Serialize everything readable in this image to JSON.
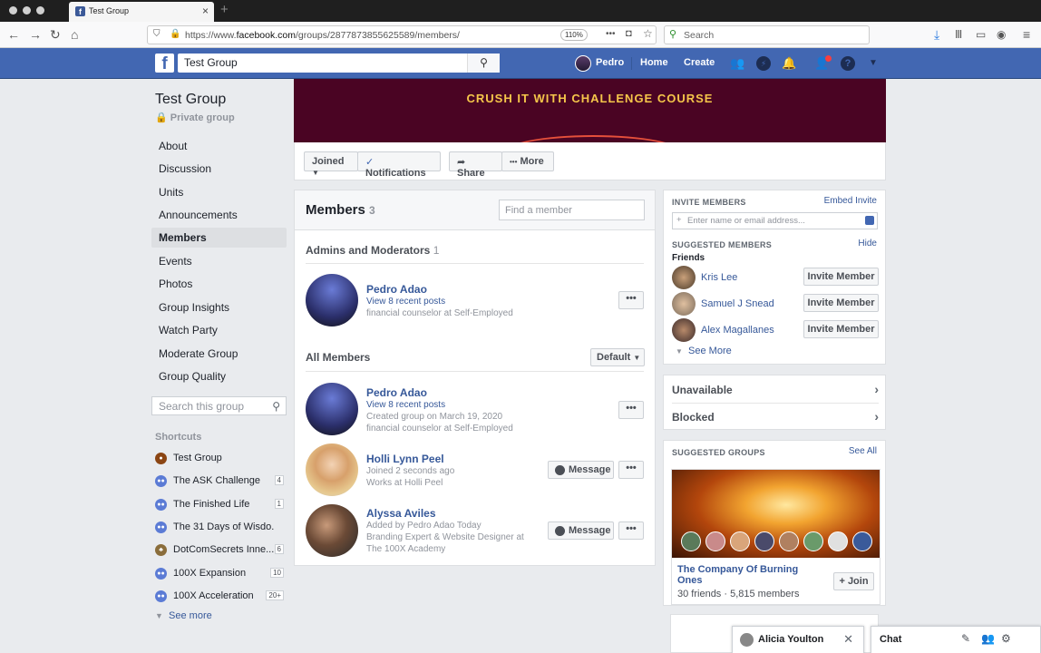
{
  "browser": {
    "tab_title": "Test Group",
    "tab_favicon": "f",
    "url_prefix": "https://www.",
    "url_host": "facebook.com",
    "url_path": "/groups/2877873855625589/members/",
    "zoom": "110%",
    "search_placeholder": "Search"
  },
  "fb": {
    "logo": "f",
    "search_value": "Test Group",
    "user": "Pedro",
    "home": "Home",
    "create": "Create"
  },
  "sidebar": {
    "group_name": "Test Group",
    "privacy": "Private group",
    "items": [
      "About",
      "Discussion",
      "Units",
      "Announcements",
      "Members",
      "Events",
      "Photos",
      "Group Insights",
      "Watch Party",
      "Moderate Group",
      "Group Quality"
    ],
    "search_placeholder": "Search this group",
    "shortcuts_heading": "Shortcuts",
    "shortcuts": [
      {
        "name": "Test Group",
        "count": ""
      },
      {
        "name": "The ASK Challenge",
        "count": "4"
      },
      {
        "name": "The Finished Life",
        "count": "1"
      },
      {
        "name": "The 31 Days of Wisdo...",
        "count": ""
      },
      {
        "name": "DotComSecrets Inne...",
        "count": "6"
      },
      {
        "name": "100X Expansion",
        "count": "10"
      },
      {
        "name": "100X Acceleration",
        "count": "20+"
      }
    ],
    "see_more": "See more"
  },
  "cover": {
    "text": "CRUSH IT WITH CHALLENGE COURSE"
  },
  "actions": {
    "joined": "Joined",
    "notifications": "Notifications",
    "share": "Share",
    "more": "More"
  },
  "members": {
    "title": "Members",
    "count": "3",
    "find_placeholder": "Find a member",
    "admins_heading": "Admins and Moderators",
    "admins_count": "1",
    "admin": {
      "name": "Pedro Adao",
      "line1": "View 8 recent posts",
      "line2": "financial counselor at Self-Employed"
    },
    "all_heading": "All Members",
    "sort": "Default",
    "list": [
      {
        "name": "Pedro Adao",
        "line1": "View 8 recent posts",
        "line2": "Created group on March 19, 2020",
        "line3": "financial counselor at Self-Employed"
      },
      {
        "name": "Holli Lynn Peel",
        "line1": "Joined 2 seconds ago",
        "line2": "Works at Holli Peel",
        "line3": ""
      },
      {
        "name": "Alyssa Aviles",
        "line1": "Added by Pedro Adao Today",
        "line2": "Branding Expert & Website Designer at",
        "line3": "The 100X Academy"
      }
    ],
    "message_label": "Message",
    "dots": "•••"
  },
  "invite": {
    "heading": "INVITE MEMBERS",
    "embed": "Embed Invite",
    "input_placeholder": "Enter name or email address...",
    "suggested_heading": "SUGGESTED MEMBERS",
    "hide": "Hide",
    "friends_label": "Friends",
    "friends": [
      "Kris Lee",
      "Samuel J Snead",
      "Alex Magallanes"
    ],
    "invite_label": "Invite Member",
    "see_more": "See More"
  },
  "status": {
    "unavailable": "Unavailable",
    "blocked": "Blocked"
  },
  "suggested_groups": {
    "heading": "SUGGESTED GROUPS",
    "see_all": "See All",
    "group_name": "The Company Of Burning Ones",
    "stats": "30 friends · 5,815 members",
    "join": "Join"
  },
  "chat": {
    "popup_name": "Alicia Youlton",
    "title": "Chat"
  }
}
